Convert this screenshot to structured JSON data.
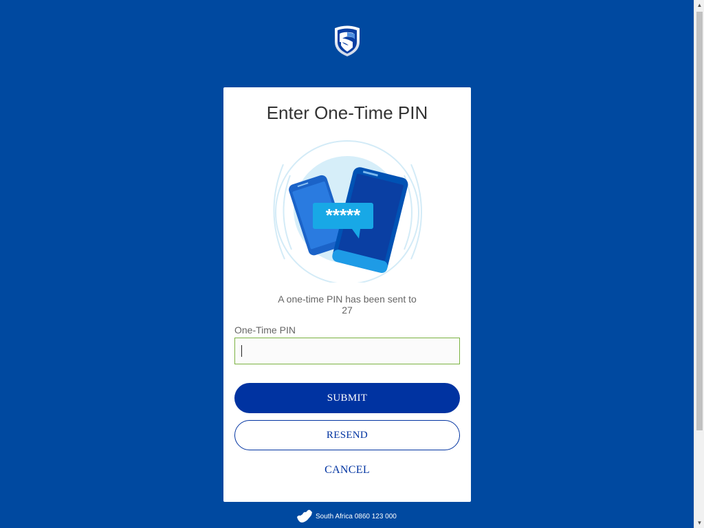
{
  "brand": {
    "logo_icon": "shield-logo-icon",
    "background": "#0049a0",
    "accent": "#0033a1"
  },
  "card": {
    "title": "Enter One-Time PIN",
    "illustration_icon": "phones-otp-illustration",
    "pin_masked": "*****",
    "message_line1": "A one-time PIN has been sent to",
    "message_line2": "27",
    "field_label": "One-Time PIN",
    "pin_value": "",
    "submit_label": "SUBMIT",
    "resend_label": "RESEND",
    "cancel_label": "CANCEL"
  },
  "footer": {
    "map_icon": "south-africa-map-icon",
    "text": "South Africa 0860 123 000"
  },
  "scrollbar": {
    "up_icon": "scroll-up-arrow-icon",
    "down_icon": "scroll-down-arrow-icon"
  }
}
